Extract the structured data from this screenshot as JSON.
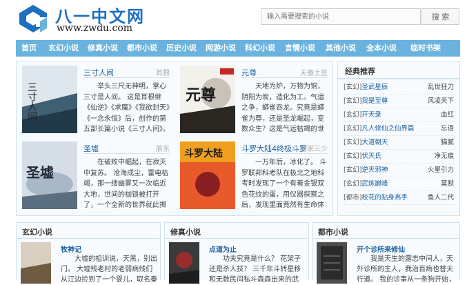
{
  "header": {
    "logo_text": "八一中文网",
    "logo_url": "www.zwdu.com",
    "search_placeholder": "输入需要搜索的小说",
    "search_button": "搜  索"
  },
  "nav": [
    "首页",
    "玄幻小说",
    "修真小说",
    "都市小说",
    "历史小说",
    "网游小说",
    "科幻小说",
    "言情小说",
    "其他小说",
    "全本小说",
    "临时书架"
  ],
  "featured": [
    {
      "title": "三寸人间",
      "author": "耳根",
      "cover_text": "三寸人间",
      "desc": "举头三尺无神明，掌心三寸是人间。    这是耳根继《仙逆》《求魔》《我欲封天》《一念永恒》后，创作的第五部长篇小说《三寸人间》。"
    },
    {
      "title": "元尊",
      "author": "天蚕土豆",
      "cover_text": "元尊",
      "desc": "天地为炉，万物为铜，阴阳为炭，造化为工。气运之争，蟒雀吞龙。究竟是蟒雀为尊，还是圣龙崛起，变数众生？这是气运枯竭的世界，磅礴宏伟，一气可撕山，可倒海，可翻天，可重阴阳韵律，可圆满…"
    },
    {
      "title": "圣墟",
      "author": "辰东",
      "cover_text": "圣墟",
      "desc": "在破败中崛起，在寂灭中复苏。 沧海成尘，雷电枯竭，那一缕幽雾又一次临近大地，世间的枷锁被打开了，一个全新的世界就此揭开神秘的一角……"
    },
    {
      "title": "斗罗大陆4终极斗罗",
      "author": "唐家三少",
      "cover_text": "斗罗大陆",
      "desc": "一万年后，冰化了。 斗罗联邦科考队在极北之地科考时发现了一个有着金银双色花纹的蛋，用仪器探察之后，发现里面竟然有生命体征，赶忙将其带回研究所进行孵化。蛋孵化出来了，可孵出来的"
    }
  ],
  "recommend": {
    "title": "经典推荐",
    "items": [
      {
        "cat": "[玄幻]",
        "name": "圣武星辰",
        "author": "乱世狂刀"
      },
      {
        "cat": "[玄幻]",
        "name": "我是至尊",
        "author": "风凌天下"
      },
      {
        "cat": "[玄幻]",
        "name": "开天录",
        "author": "血红"
      },
      {
        "cat": "[玄幻]",
        "name": "凡人修仙之仙界篇",
        "author": "忘语"
      },
      {
        "cat": "[玄幻]",
        "name": "大道朝天",
        "author": "猫腻"
      },
      {
        "cat": "[玄幻]",
        "name": "伏天氏",
        "author": "净无痕"
      },
      {
        "cat": "[玄幻]",
        "name": "逆天邪神",
        "author": "火星引力"
      },
      {
        "cat": "[玄幻]",
        "name": "武炼巅峰",
        "author": "莫默"
      },
      {
        "cat": "[都市]",
        "name": "校花的贴身高手",
        "author": "鱼人二代"
      }
    ]
  },
  "categories": [
    {
      "title": "玄幻小说",
      "book": "牧神记",
      "desc": "大墟的祖训说，天黑，别出门。 大墟残老村的老弱病残们从江边捡到了一个婴儿，取名秦牧，含辛茹苦将他养大。"
    },
    {
      "title": "修真小说",
      "book": "点道为止",
      "desc": "功夫究竟是什么？ 花架子还是杀人技？ 三千年斗转星移和无数民间私斗森森出来的武术，究竟是不是骗局？ 国术流开"
    },
    {
      "title": "都市小说",
      "book": "开个诊所来修仙",
      "desc": "我是天生的露志中间人，天外诊所的主人，我治百病也替天行道。 我的诊事从一条狗开始，那一夜它送了我一个诊所……"
    }
  ]
}
